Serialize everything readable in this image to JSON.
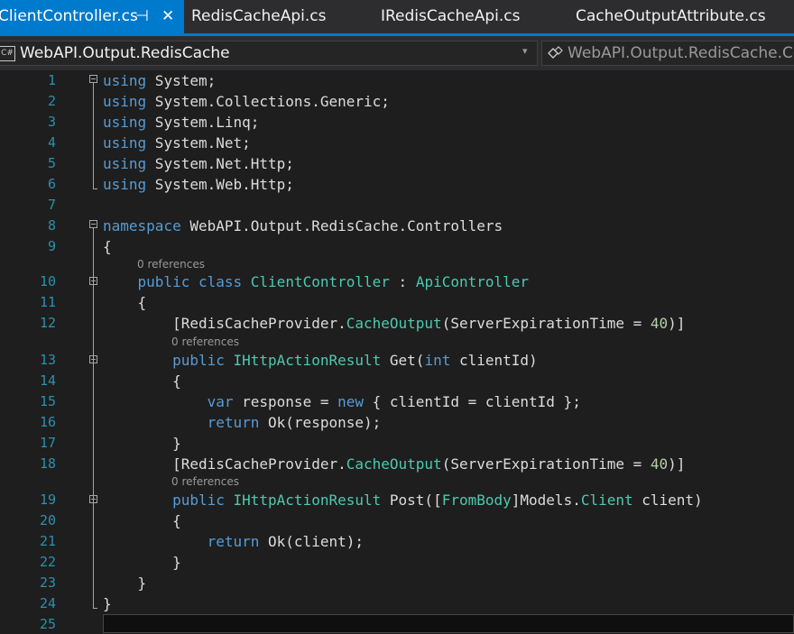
{
  "tabs": [
    {
      "label": "ClientController.cs",
      "active": true,
      "pin_icon": "pin-icon",
      "close_icon": "close-icon",
      "pin": "⊣",
      "close": "✕"
    },
    {
      "label": "RedisCacheApi.cs",
      "active": false
    },
    {
      "label": "IRedisCacheApi.cs",
      "active": false
    },
    {
      "label": "CacheOutputAttribute.cs",
      "active": false
    }
  ],
  "nav": {
    "project_icon": "C#",
    "project": "WebAPI.Output.RedisCache",
    "dropdown_icon": "▾",
    "member_icon": "class-icon",
    "member": "WebAPI.Output.RedisCache.Cor"
  },
  "code_lens": {
    "refs": "0 references"
  },
  "line_numbers": [
    "1",
    "2",
    "3",
    "4",
    "5",
    "6",
    "7",
    "8",
    "9",
    "10",
    "11",
    "12",
    "13",
    "14",
    "15",
    "16",
    "17",
    "18",
    "19",
    "20",
    "21",
    "22",
    "23",
    "24",
    "25"
  ],
  "code": {
    "l1": [
      {
        "t": "using",
        "c": "kw"
      },
      {
        "t": " System;"
      }
    ],
    "l2": [
      {
        "t": "using",
        "c": "kw"
      },
      {
        "t": " System.Collections.Generic;"
      }
    ],
    "l3": [
      {
        "t": "using",
        "c": "kw"
      },
      {
        "t": " System.Linq;"
      }
    ],
    "l4": [
      {
        "t": "using",
        "c": "kw"
      },
      {
        "t": " System.Net;"
      }
    ],
    "l5": [
      {
        "t": "using",
        "c": "kw"
      },
      {
        "t": " System.Net.Http;"
      }
    ],
    "l6": [
      {
        "t": "using",
        "c": "kw"
      },
      {
        "t": " System.Web.Http;"
      }
    ],
    "l7": [],
    "l8": [
      {
        "t": "namespace",
        "c": "kw"
      },
      {
        "t": " WebAPI.Output.RedisCache.Controllers"
      }
    ],
    "l9": [
      {
        "t": "{"
      }
    ],
    "l10": [
      {
        "t": "    "
      },
      {
        "t": "public",
        "c": "kw"
      },
      {
        "t": " "
      },
      {
        "t": "class",
        "c": "kw"
      },
      {
        "t": " "
      },
      {
        "t": "ClientController",
        "c": "ty"
      },
      {
        "t": " : "
      },
      {
        "t": "ApiController",
        "c": "ty"
      }
    ],
    "l11": [
      {
        "t": "    {"
      }
    ],
    "l12": [
      {
        "t": "        [RedisCacheProvider."
      },
      {
        "t": "CacheOutput",
        "c": "ty"
      },
      {
        "t": "(ServerExpirationTime = "
      },
      {
        "t": "40",
        "c": "nm"
      },
      {
        "t": ")]"
      }
    ],
    "l13": [
      {
        "t": "        "
      },
      {
        "t": "public",
        "c": "kw"
      },
      {
        "t": " "
      },
      {
        "t": "IHttpActionResult",
        "c": "ty"
      },
      {
        "t": " Get("
      },
      {
        "t": "int",
        "c": "kw"
      },
      {
        "t": " clientId)"
      }
    ],
    "l14": [
      {
        "t": "        {"
      }
    ],
    "l15": [
      {
        "t": "            "
      },
      {
        "t": "var",
        "c": "kw"
      },
      {
        "t": " response = "
      },
      {
        "t": "new",
        "c": "kw"
      },
      {
        "t": " { clientId = clientId };"
      }
    ],
    "l16": [
      {
        "t": "            "
      },
      {
        "t": "return",
        "c": "kw"
      },
      {
        "t": " Ok(response);"
      }
    ],
    "l17": [
      {
        "t": "        }"
      }
    ],
    "l18": [
      {
        "t": "        [RedisCacheProvider."
      },
      {
        "t": "CacheOutput",
        "c": "ty"
      },
      {
        "t": "(ServerExpirationTime = "
      },
      {
        "t": "40",
        "c": "nm"
      },
      {
        "t": ")]"
      }
    ],
    "l19": [
      {
        "t": "        "
      },
      {
        "t": "public",
        "c": "kw"
      },
      {
        "t": " "
      },
      {
        "t": "IHttpActionResult",
        "c": "ty"
      },
      {
        "t": " Post([",
        "c": ""
      },
      {
        "t": "FromBody",
        "c": "ty"
      },
      {
        "t": "]Models."
      },
      {
        "t": "Client",
        "c": "ty"
      },
      {
        "t": " client)"
      }
    ],
    "l20": [
      {
        "t": "        {"
      }
    ],
    "l21": [
      {
        "t": "            "
      },
      {
        "t": "return",
        "c": "kw"
      },
      {
        "t": " Ok(client);"
      }
    ],
    "l22": [
      {
        "t": "        }"
      }
    ],
    "l23": [
      {
        "t": "    }"
      }
    ],
    "l24": [
      {
        "t": "}"
      }
    ],
    "l25": []
  },
  "colors": {
    "accent": "#007acc",
    "keyword": "#569cd6",
    "type": "#4ec9b0",
    "number": "#b5cea8",
    "line_number": "#2b91af"
  }
}
